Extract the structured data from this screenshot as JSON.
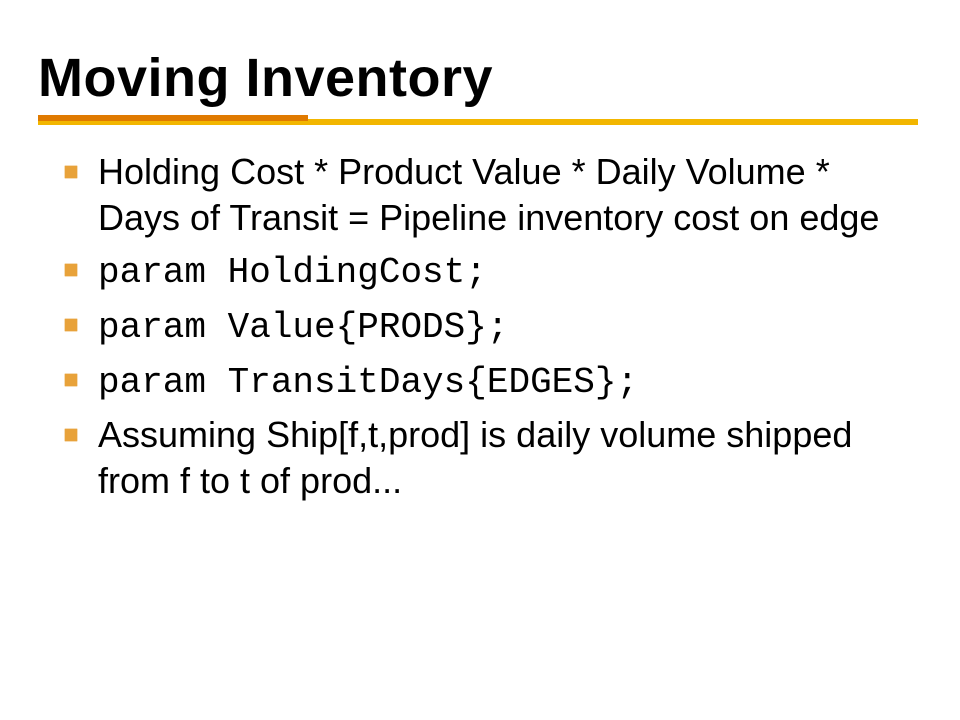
{
  "title": "Moving Inventory",
  "bullets": [
    {
      "text": "Holding Cost * Product Value * Daily Volume * Days of Transit = Pipeline inventory cost on edge",
      "style": "serif"
    },
    {
      "text": "param HoldingCost;",
      "style": "mono"
    },
    {
      "text": "param Value{PRODS};",
      "style": "mono"
    },
    {
      "text": "param TransitDays{EDGES};",
      "style": "mono"
    },
    {
      "text": "Assuming Ship[f,t,prod] is daily volume shipped from f to t of prod...",
      "style": "serif"
    }
  ]
}
